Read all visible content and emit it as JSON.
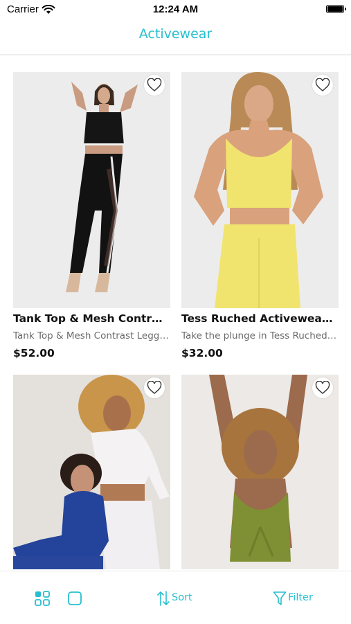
{
  "status_bar": {
    "carrier": "Carrier",
    "time": "12:24 AM"
  },
  "header": {
    "title": "Activewear"
  },
  "products": [
    {
      "title": "Tank Top & Mesh Contrast Leggings Set",
      "description": "Tank Top & Mesh Contrast Leggings Set",
      "price": "$52.00"
    },
    {
      "title": "Tess Ruched Activewear Set",
      "description": "Take the plunge in Tess Ruched Activewear Set",
      "price": "$32.00"
    },
    {
      "title": "",
      "description": "",
      "price": ""
    },
    {
      "title": "",
      "description": "",
      "price": ""
    }
  ],
  "bottom_bar": {
    "sort_label": "Sort",
    "filter_label": "Filter",
    "icons": [
      "grid-view-icon",
      "single-view-icon",
      "sort-icon",
      "filter-icon"
    ]
  },
  "colors": {
    "accent": "#26bfcf"
  }
}
